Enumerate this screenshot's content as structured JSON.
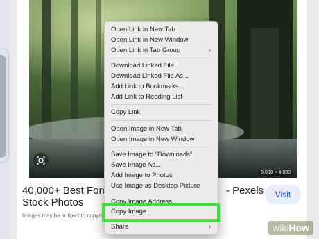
{
  "result": {
    "dimensions": "6,000 × 4,000",
    "title_left": "40,000+ Best Forest",
    "title_left_line2": "Stock Photos",
    "title_right": "- Pexels",
    "visit_label": "Visit",
    "copyright": "Images may be subject to copyri"
  },
  "context_menu": {
    "items": [
      {
        "label": "Open Link in New Tab"
      },
      {
        "label": "Open Link in New Window"
      },
      {
        "label": "Open Link in Tab Group",
        "submenu": "›"
      },
      {
        "label": "Download Linked File"
      },
      {
        "label": "Download Linked File As..."
      },
      {
        "label": "Add Link to Bookmarks..."
      },
      {
        "label": "Add Link to Reading List"
      },
      {
        "label": "Copy Link"
      },
      {
        "label": "Open Image in New Tab"
      },
      {
        "label": "Open Image in New Window"
      },
      {
        "label": "Save Image to “Downloads”"
      },
      {
        "label": "Save Image As..."
      },
      {
        "label": "Add Image to Photos"
      },
      {
        "label": "Use Image as Desktop Picture"
      },
      {
        "label": "Copy Image Address"
      },
      {
        "label": "Copy Image"
      },
      {
        "label": "Share",
        "submenu": "›"
      }
    ],
    "highlight_color": "#35e33a"
  },
  "watermark": {
    "part1": "wiki",
    "part2": "How"
  }
}
